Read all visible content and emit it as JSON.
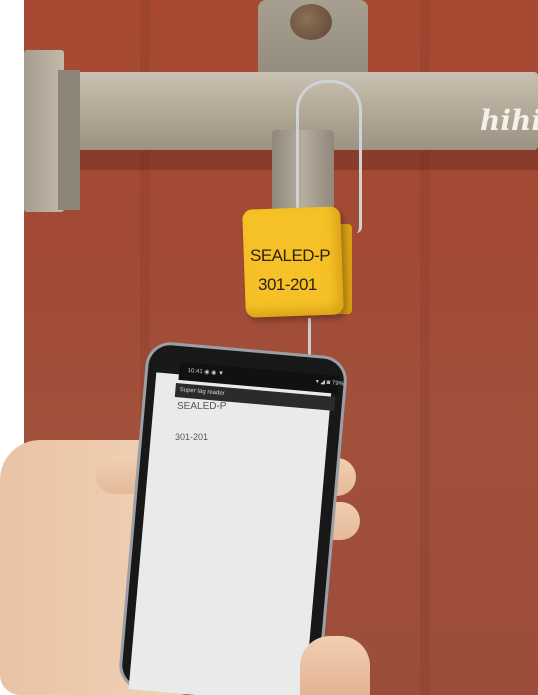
{
  "photo": {
    "description_free": true,
    "tag": {
      "line1": "SEALED-P",
      "line2": "301-201"
    },
    "door_writing": "hihi",
    "phone": {
      "status_time": "10:41 ◉ ◉ ▼",
      "status_icons": "▾ ◢ ◙ 79%",
      "app_title": "Super tag reader",
      "screen_line1": "SEALED-P",
      "screen_line2": "301-201"
    },
    "colors": {
      "container_wall": "#a24a35",
      "tag_yellow": "#f6c126",
      "phone_screen": "#e9ebea"
    }
  }
}
